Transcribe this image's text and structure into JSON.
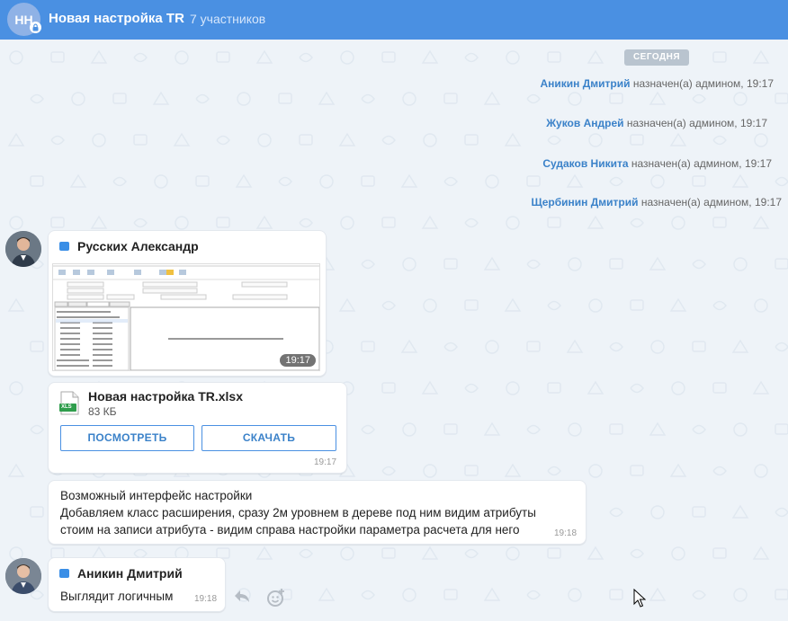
{
  "header": {
    "avatar_initials": "НН",
    "title": "Новая настройка TR",
    "members": "7 участников"
  },
  "date_chip": "СЕГОДНЯ",
  "system_messages": [
    {
      "name": "Аникин Дмитрий",
      "text": "назначен(а) админом, 19:17"
    },
    {
      "name": "Жуков Андрей",
      "text": "назначен(а) админом, 19:17"
    },
    {
      "name": "Судаков Никита",
      "text": "назначен(а) админом, 19:17"
    },
    {
      "name": "Щербинин Дмитрий",
      "text": "назначен(а) админом, 19:17"
    }
  ],
  "messages": {
    "m1": {
      "sender": "Русских Александр",
      "image_time": "19:17"
    },
    "file": {
      "name": "Новая настройка TR.xlsx",
      "size": "83 КБ",
      "badge": "XLS",
      "view_label": "ПОСМОТРЕТЬ",
      "download_label": "СКАЧАТЬ",
      "time": "19:17"
    },
    "text1": {
      "lines": [
        "Возможный интерфейс настройки",
        "Добавляем класс расширения, сразу 2м уровнем в дереве под ним видим атрибуты",
        "стоим на записи атрибута - видим справа настройки параметра расчета для него"
      ],
      "time": "19:18"
    },
    "m2": {
      "sender": "Аникин Дмитрий",
      "text": "Выглядит логичным",
      "time": "19:18"
    }
  },
  "colors": {
    "header": "#4a90e2",
    "accent": "#3b82c9",
    "background": "#eef3f8"
  },
  "icons": [
    "lock-icon",
    "role-icon",
    "xls-file-icon",
    "reply-icon",
    "emoji-icon",
    "mouse-cursor-icon"
  ]
}
